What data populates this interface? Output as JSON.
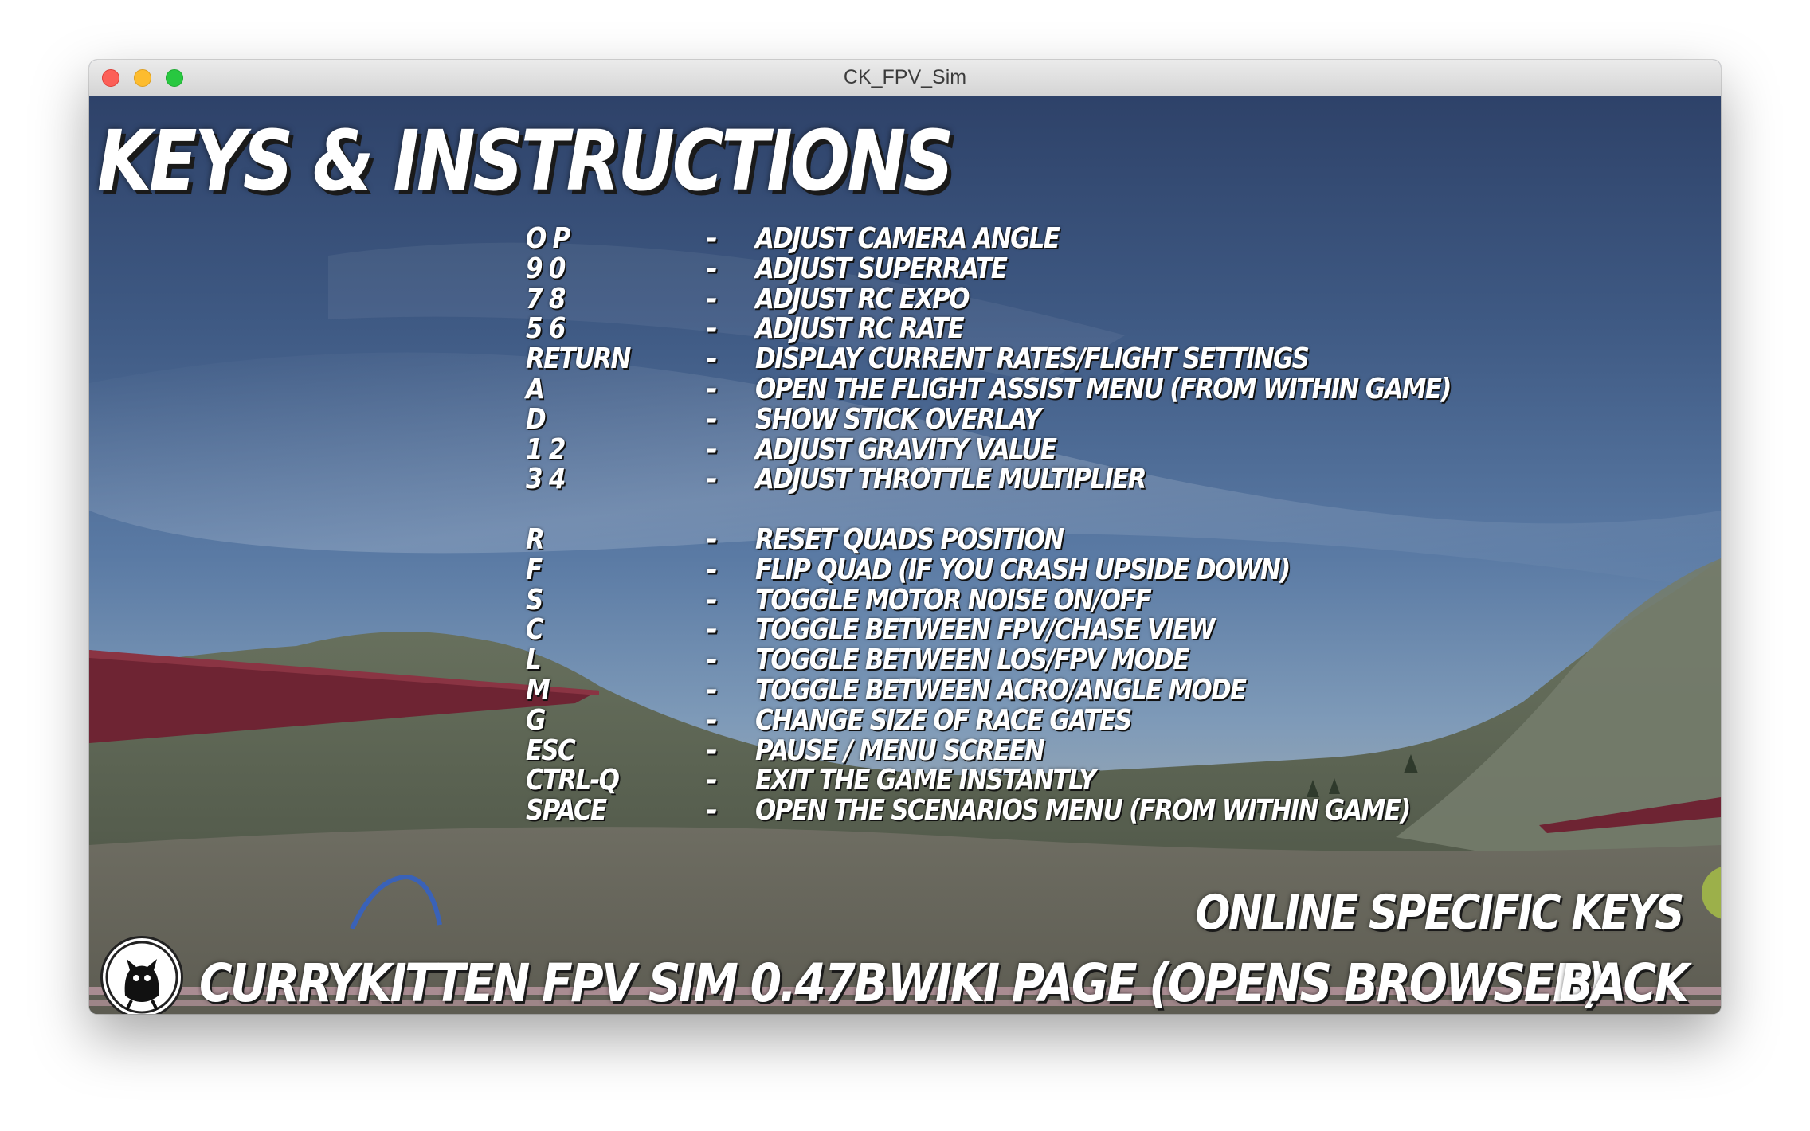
{
  "window": {
    "title": "CK_FPV_Sim"
  },
  "screen": {
    "heading": "Keys & Instructions",
    "keys": [
      {
        "key": "O  P",
        "sep": "-",
        "action": "Adjust camera angle"
      },
      {
        "key": "9  0",
        "sep": "-",
        "action": "Adjust SuperRate"
      },
      {
        "key": "7  8",
        "sep": "-",
        "action": "Adjust RC Expo"
      },
      {
        "key": "5  6",
        "sep": "-",
        "action": "Adjust RC Rate"
      },
      {
        "key": "Return",
        "sep": "-",
        "action": "Display current rates/flight settings"
      },
      {
        "key": "A",
        "sep": "-",
        "action": "Open the flight assist menu (from within game)"
      },
      {
        "key": "D",
        "sep": "-",
        "action": "Show stick overlay"
      },
      {
        "key": "1  2",
        "sep": "-",
        "action": "Adjust gravity value"
      },
      {
        "key": "3  4",
        "sep": "-",
        "action": "Adjust throttle multiplier"
      },
      {
        "key": "R",
        "sep": "-",
        "action": "Reset quads position"
      },
      {
        "key": "F",
        "sep": "-",
        "action": "Flip quad (if you crash upside down)"
      },
      {
        "key": "S",
        "sep": "-",
        "action": "Toggle motor noise on/off"
      },
      {
        "key": "C",
        "sep": "-",
        "action": "Toggle between FPV/Chase view"
      },
      {
        "key": "L",
        "sep": "-",
        "action": "Toggle between LOS/FPV mode"
      },
      {
        "key": "M",
        "sep": "-",
        "action": "Toggle between acro/angle mode"
      },
      {
        "key": "G",
        "sep": "-",
        "action": "Change size of race gates"
      },
      {
        "key": "Esc",
        "sep": "-",
        "action": "Pause / Menu screen"
      },
      {
        "key": "Ctrl-Q",
        "sep": "-",
        "action": "Exit the game instantly"
      },
      {
        "key": "Space",
        "sep": "-",
        "action": "Open the scenarios menu (from within game)"
      }
    ],
    "online_keys_label": "Online specific keys",
    "version_label": "CurryKitten FPV Sim 0.47b",
    "wiki_label": "Wiki page (opens browser)",
    "back_label": "Back",
    "logo_text": "CurryKitten FPV",
    "colors": {
      "text": "#ffffff",
      "text_shadow": "#1a1a1a",
      "sky_top": "#2e4269",
      "ground": "#5f6754",
      "gate": "#6e2433"
    }
  }
}
